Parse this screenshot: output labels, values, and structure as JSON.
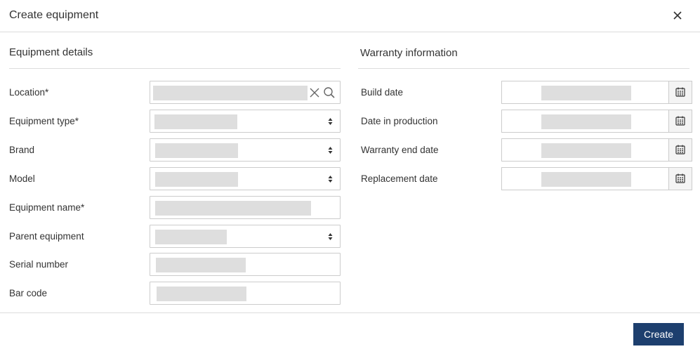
{
  "dialog": {
    "title": "Create equipment",
    "submit_label": "Create"
  },
  "equipment_details": {
    "title": "Equipment details",
    "fields": [
      {
        "label": "Location*",
        "type": "lookup"
      },
      {
        "label": "Equipment type*",
        "type": "select"
      },
      {
        "label": "Brand",
        "type": "select"
      },
      {
        "label": "Model",
        "type": "select"
      },
      {
        "label": "Equipment name*",
        "type": "text"
      },
      {
        "label": "Parent equipment",
        "type": "select"
      },
      {
        "label": "Serial number",
        "type": "text"
      },
      {
        "label": "Bar code",
        "type": "text"
      }
    ]
  },
  "warranty_information": {
    "title": "Warranty information",
    "fields": [
      {
        "label": "Build date",
        "type": "date"
      },
      {
        "label": "Date in production",
        "type": "date"
      },
      {
        "label": "Warranty end date",
        "type": "date"
      },
      {
        "label": "Replacement date",
        "type": "date"
      }
    ]
  },
  "icons": {
    "close": "close-icon",
    "clear": "clear-icon",
    "search": "search-icon",
    "select": "sort-arrows-icon",
    "calendar": "calendar-icon"
  },
  "colors": {
    "primary_button": "#1d3f6e",
    "border": "#cccccc",
    "placeholder": "#dedede"
  }
}
